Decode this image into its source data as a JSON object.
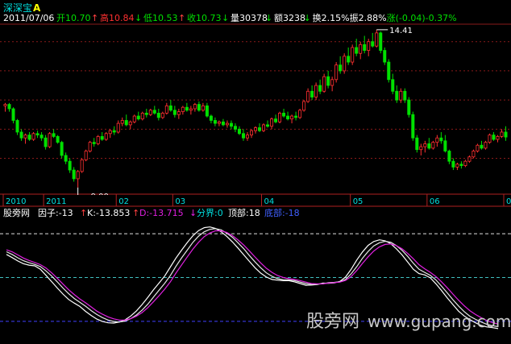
{
  "app": {
    "title": "深深宝",
    "title_marker": "A"
  },
  "quote_bar": {
    "date": "2011/07/06",
    "items": [
      {
        "label": "开",
        "value": "10.70",
        "arrow": "↑",
        "color": "#00e000"
      },
      {
        "label": "高",
        "value": "10.84",
        "arrow": "↓",
        "color": "#ff3030"
      },
      {
        "label": "低",
        "value": "10.53",
        "arrow": "↑",
        "color": "#00e000"
      },
      {
        "label": "收",
        "value": "10.73",
        "arrow": "↓",
        "color": "#00e000"
      },
      {
        "label": "量",
        "value": "30378",
        "arrow": "↓",
        "color": "#ffffff"
      },
      {
        "label": "额",
        "value": "3238",
        "arrow": "↓",
        "color": "#ffffff"
      },
      {
        "label": "换",
        "value": "2.15%",
        "arrow": "",
        "color": "#ffffff"
      },
      {
        "label": "振",
        "value": "2.88%",
        "arrow": "",
        "color": "#ffffff"
      },
      {
        "label": "涨",
        "value": "(-0.04)-0.37%",
        "arrow": "",
        "color": "#00e000"
      }
    ]
  },
  "indicator_bar": {
    "name": "股旁网",
    "factor": "因子:-13",
    "k": "K:-13.853",
    "d": "D:-13.715",
    "boundary": "分界:0",
    "top": "顶部:18",
    "bottom": "底部:-18",
    "arrow_k": "↑",
    "arrow_d": "↑",
    "arrow_bound": "↓"
  },
  "watermark": {
    "cn": "股旁网",
    "url": "www.gupang.com"
  },
  "chart_data": [
    {
      "type": "candlestick",
      "title": "",
      "time_axis": {
        "labels": [
          "2010",
          "2011",
          "02",
          "03",
          "04",
          "05",
          "06",
          "07"
        ],
        "label_candle_index": [
          0,
          10,
          28,
          42,
          64,
          86,
          105,
          124
        ]
      },
      "annotations": [
        {
          "text": "14.41",
          "candle_index": 92,
          "price": 14.41,
          "kind": "high"
        },
        {
          "text": "9.00",
          "candle_index": 18,
          "price": 9.0,
          "kind": "low"
        }
      ],
      "ylim": [
        8.8,
        14.6
      ],
      "grid": "dotted horizontal",
      "colors": {
        "up": "#ff3030",
        "down": "#00e000",
        "grid": "#8a1a1a"
      },
      "candles": [
        [
          11.8,
          11.9,
          11.6,
          11.85
        ],
        [
          11.85,
          11.9,
          11.6,
          11.7
        ],
        [
          11.7,
          11.75,
          11.2,
          11.3
        ],
        [
          11.3,
          11.35,
          10.8,
          10.9
        ],
        [
          10.9,
          11.0,
          10.6,
          10.7
        ],
        [
          10.7,
          10.85,
          10.5,
          10.8
        ],
        [
          10.8,
          10.9,
          10.6,
          10.65
        ],
        [
          10.65,
          10.9,
          10.6,
          10.85
        ],
        [
          10.85,
          10.95,
          10.7,
          10.8
        ],
        [
          10.8,
          10.9,
          10.6,
          10.7
        ],
        [
          10.7,
          10.8,
          10.3,
          10.4
        ],
        [
          10.4,
          10.9,
          10.35,
          10.85
        ],
        [
          10.85,
          11.0,
          10.7,
          10.75
        ],
        [
          10.75,
          10.8,
          10.5,
          10.55
        ],
        [
          10.55,
          10.6,
          10.0,
          10.1
        ],
        [
          10.1,
          10.2,
          9.8,
          9.9
        ],
        [
          9.9,
          10.0,
          9.5,
          9.6
        ],
        [
          9.6,
          9.7,
          9.2,
          9.3
        ],
        [
          9.3,
          9.6,
          9.0,
          9.55
        ],
        [
          9.55,
          10.0,
          9.5,
          9.95
        ],
        [
          9.95,
          10.3,
          9.9,
          10.25
        ],
        [
          10.25,
          10.6,
          10.2,
          10.55
        ],
        [
          10.55,
          10.7,
          10.4,
          10.5
        ],
        [
          10.5,
          10.8,
          10.45,
          10.75
        ],
        [
          10.75,
          10.9,
          10.6,
          10.65
        ],
        [
          10.65,
          10.9,
          10.6,
          10.85
        ],
        [
          10.85,
          11.0,
          10.7,
          10.95
        ],
        [
          10.95,
          11.1,
          10.8,
          10.9
        ],
        [
          10.9,
          11.3,
          10.85,
          11.2
        ],
        [
          11.2,
          11.4,
          11.1,
          11.3
        ],
        [
          11.3,
          11.5,
          11.1,
          11.15
        ],
        [
          11.15,
          11.3,
          11.0,
          11.25
        ],
        [
          11.25,
          11.5,
          11.2,
          11.45
        ],
        [
          11.45,
          11.6,
          11.3,
          11.35
        ],
        [
          11.35,
          11.6,
          11.3,
          11.55
        ],
        [
          11.55,
          11.7,
          11.4,
          11.5
        ],
        [
          11.5,
          11.7,
          11.45,
          11.65
        ],
        [
          11.65,
          11.8,
          11.5,
          11.55
        ],
        [
          11.55,
          11.7,
          11.3,
          11.4
        ],
        [
          11.4,
          11.6,
          11.35,
          11.55
        ],
        [
          11.55,
          11.9,
          11.5,
          11.8
        ],
        [
          11.8,
          12.0,
          11.6,
          11.65
        ],
        [
          11.65,
          11.8,
          11.4,
          11.5
        ],
        [
          11.5,
          11.7,
          11.35,
          11.6
        ],
        [
          11.6,
          11.8,
          11.5,
          11.75
        ],
        [
          11.75,
          11.9,
          11.6,
          11.65
        ],
        [
          11.65,
          11.8,
          11.5,
          11.7
        ],
        [
          11.7,
          11.9,
          11.6,
          11.85
        ],
        [
          11.85,
          11.95,
          11.6,
          11.65
        ],
        [
          11.65,
          11.9,
          11.6,
          11.8
        ],
        [
          11.8,
          11.9,
          11.4,
          11.45
        ],
        [
          11.45,
          11.5,
          11.2,
          11.3
        ],
        [
          11.3,
          11.4,
          11.1,
          11.2
        ],
        [
          11.2,
          11.3,
          11.1,
          11.25
        ],
        [
          11.25,
          11.35,
          11.1,
          11.15
        ],
        [
          11.15,
          11.3,
          11.05,
          11.2
        ],
        [
          11.2,
          11.3,
          11.0,
          11.1
        ],
        [
          11.1,
          11.2,
          10.9,
          11.0
        ],
        [
          11.0,
          11.1,
          10.8,
          10.85
        ],
        [
          10.85,
          11.0,
          10.6,
          10.7
        ],
        [
          10.7,
          10.9,
          10.6,
          10.8
        ],
        [
          10.8,
          11.0,
          10.7,
          10.95
        ],
        [
          10.95,
          11.1,
          10.85,
          11.05
        ],
        [
          11.05,
          11.2,
          10.9,
          10.95
        ],
        [
          10.95,
          11.2,
          10.9,
          11.15
        ],
        [
          11.15,
          11.3,
          11.05,
          11.1
        ],
        [
          11.1,
          11.4,
          11.0,
          11.35
        ],
        [
          11.35,
          11.5,
          11.2,
          11.25
        ],
        [
          11.25,
          11.6,
          11.2,
          11.55
        ],
        [
          11.55,
          11.7,
          11.4,
          11.45
        ],
        [
          11.45,
          11.6,
          11.3,
          11.35
        ],
        [
          11.35,
          11.5,
          11.2,
          11.45
        ],
        [
          11.45,
          11.6,
          11.3,
          11.4
        ],
        [
          11.4,
          11.7,
          11.35,
          11.65
        ],
        [
          11.65,
          12.0,
          11.6,
          11.95
        ],
        [
          11.95,
          12.4,
          11.9,
          12.3
        ],
        [
          12.3,
          12.5,
          12.0,
          12.1
        ],
        [
          12.1,
          12.6,
          12.0,
          12.5
        ],
        [
          12.5,
          12.7,
          12.2,
          12.3
        ],
        [
          12.3,
          12.9,
          12.25,
          12.8
        ],
        [
          12.8,
          13.0,
          12.4,
          12.5
        ],
        [
          12.5,
          12.8,
          12.3,
          12.7
        ],
        [
          12.7,
          13.3,
          12.6,
          13.2
        ],
        [
          13.2,
          13.5,
          12.9,
          13.0
        ],
        [
          13.0,
          13.6,
          12.9,
          13.5
        ],
        [
          13.5,
          13.8,
          13.2,
          13.3
        ],
        [
          13.3,
          13.9,
          13.2,
          13.8
        ],
        [
          13.8,
          14.1,
          13.5,
          13.6
        ],
        [
          13.6,
          14.0,
          13.4,
          13.9
        ],
        [
          13.9,
          14.2,
          13.6,
          13.7
        ],
        [
          13.7,
          14.1,
          13.5,
          14.0
        ],
        [
          14.0,
          14.3,
          13.8,
          13.85
        ],
        [
          13.85,
          14.41,
          13.8,
          14.3
        ],
        [
          14.3,
          14.35,
          13.6,
          13.7
        ],
        [
          13.7,
          13.8,
          13.2,
          13.3
        ],
        [
          13.3,
          13.4,
          12.6,
          12.7
        ],
        [
          12.7,
          12.9,
          12.2,
          12.3
        ],
        [
          12.3,
          12.5,
          11.9,
          12.0
        ],
        [
          12.0,
          12.4,
          11.9,
          12.3
        ],
        [
          12.3,
          12.4,
          11.9,
          12.0
        ],
        [
          12.0,
          12.1,
          11.4,
          11.5
        ],
        [
          11.5,
          11.6,
          10.6,
          10.7
        ],
        [
          10.7,
          10.8,
          10.2,
          10.3
        ],
        [
          10.3,
          10.5,
          10.1,
          10.4
        ],
        [
          10.4,
          10.6,
          10.2,
          10.5
        ],
        [
          10.5,
          10.7,
          10.3,
          10.35
        ],
        [
          10.35,
          10.6,
          10.3,
          10.55
        ],
        [
          10.55,
          10.8,
          10.4,
          10.7
        ],
        [
          10.7,
          10.9,
          10.5,
          10.6
        ],
        [
          10.6,
          10.8,
          10.2,
          10.25
        ],
        [
          10.25,
          10.3,
          9.8,
          9.9
        ],
        [
          9.9,
          10.0,
          9.6,
          9.7
        ],
        [
          9.7,
          9.85,
          9.6,
          9.8
        ],
        [
          9.8,
          9.9,
          9.65,
          9.75
        ],
        [
          9.75,
          9.95,
          9.7,
          9.9
        ],
        [
          9.9,
          10.1,
          9.85,
          10.05
        ],
        [
          10.05,
          10.3,
          10.0,
          10.25
        ],
        [
          10.25,
          10.5,
          10.2,
          10.45
        ],
        [
          10.45,
          10.6,
          10.3,
          10.35
        ],
        [
          10.35,
          10.6,
          10.3,
          10.55
        ],
        [
          10.55,
          10.85,
          10.5,
          10.8
        ],
        [
          10.8,
          10.9,
          10.6,
          10.65
        ],
        [
          10.65,
          10.8,
          10.55,
          10.75
        ],
        [
          10.75,
          11.0,
          10.7,
          10.9
        ],
        [
          10.9,
          11.1,
          10.6,
          10.73
        ]
      ]
    },
    {
      "type": "line",
      "title": "",
      "ylim": [
        -26,
        24
      ],
      "reference_lines": [
        {
          "value": 18,
          "color": "#e0e0e0",
          "style": "dashed"
        },
        {
          "value": 0,
          "color": "#40c0c0",
          "style": "dashed"
        },
        {
          "value": -18,
          "color": "#4040ff",
          "style": "dashed"
        }
      ],
      "series": [
        {
          "name": "因子",
          "color": "#ffffff",
          "values": [
            9.5,
            8.2,
            6.8,
            5.7,
            5.1,
            4.8,
            3.4,
            0.9,
            -1.7,
            -4.3,
            -6.8,
            -9.0,
            -10.5,
            -11.9,
            -13.9,
            -15.6,
            -17.1,
            -18.1,
            -18.6,
            -18.7,
            -18.3,
            -17.4,
            -15.8,
            -13.7,
            -11.1,
            -8.2,
            -5.1,
            -2.3,
            0.6,
            4.3,
            8.0,
            11.3,
            14.4,
            17.2,
            19.3,
            20.5,
            20.8,
            20.2,
            18.8,
            16.9,
            14.6,
            12.0,
            9.3,
            6.6,
            4.0,
            1.8,
            0.2,
            -0.8,
            -1.1,
            -1.3,
            -1.3,
            -1.8,
            -2.5,
            -3.2,
            -3.1,
            -2.9,
            -2.3,
            -2.4,
            -2.2,
            -1.6,
            0.2,
            3.4,
            7.2,
            10.5,
            13.2,
            14.8,
            15.5,
            15.1,
            13.9,
            11.8,
            9.3,
            6.4,
            3.4,
            1.6,
            1.1,
            -0.1,
            -2.6,
            -5.4,
            -8.4,
            -11.1,
            -13.8,
            -15.8,
            -17.3,
            -18.6,
            -19.7,
            -20.3,
            -20.6,
            -21.0
          ]
        },
        {
          "name": "K",
          "color": "#e8e8e8",
          "values": [
            10.6,
            9.5,
            8.1,
            6.9,
            6.1,
            5.4,
            4.5,
            2.7,
            0.6,
            -1.8,
            -4.3,
            -6.6,
            -8.6,
            -10.2,
            -11.8,
            -13.6,
            -15.2,
            -16.5,
            -17.5,
            -18.1,
            -18.3,
            -17.9,
            -16.9,
            -15.4,
            -13.4,
            -11.0,
            -8.1,
            -5.2,
            -2.4,
            0.8,
            4.6,
            8.1,
            11.3,
            14.5,
            17.0,
            18.8,
            19.8,
            20.1,
            19.6,
            18.2,
            16.5,
            14.2,
            11.8,
            9.0,
            6.4,
            4.0,
            1.9,
            0.5,
            -0.5,
            -0.9,
            -1.0,
            -1.3,
            -1.9,
            -2.5,
            -2.9,
            -2.7,
            -2.6,
            -2.1,
            -2.0,
            -1.8,
            -0.8,
            1.5,
            4.5,
            7.9,
            10.7,
            13.0,
            14.3,
            14.9,
            14.5,
            13.1,
            11.2,
            8.7,
            5.9,
            3.4,
            2.1,
            0.9,
            -1.0,
            -3.6,
            -6.3,
            -9.1,
            -11.7,
            -14.0,
            -15.9,
            -17.2,
            -18.3,
            -19.2,
            -19.8,
            -20.2
          ]
        },
        {
          "name": "D",
          "color": "#e020e0",
          "values": [
            11.4,
            10.6,
            9.3,
            8.0,
            7.0,
            6.2,
            5.3,
            3.9,
            1.9,
            -0.3,
            -2.7,
            -5.0,
            -7.0,
            -8.8,
            -10.4,
            -12.1,
            -13.8,
            -15.1,
            -16.2,
            -17.0,
            -17.5,
            -17.5,
            -16.9,
            -15.9,
            -14.4,
            -12.4,
            -10.0,
            -7.5,
            -4.8,
            -1.8,
            1.8,
            5.2,
            8.5,
            11.7,
            14.5,
            16.8,
            18.3,
            19.2,
            19.2,
            18.5,
            17.2,
            15.4,
            13.3,
            10.9,
            8.4,
            6.0,
            3.8,
            2.1,
            0.8,
            0.0,
            -0.5,
            -0.8,
            -1.3,
            -1.9,
            -2.5,
            -2.6,
            -2.6,
            -2.3,
            -2.1,
            -1.9,
            -1.2,
            0.4,
            2.9,
            5.8,
            8.5,
            10.9,
            12.6,
            13.6,
            13.8,
            13.1,
            11.8,
            9.9,
            7.7,
            5.3,
            3.6,
            2.1,
            0.4,
            -1.8,
            -4.2,
            -6.8,
            -9.3,
            -11.6,
            -13.6,
            -15.2,
            -16.5,
            -17.7,
            -18.5,
            -19.1
          ]
        }
      ]
    }
  ]
}
